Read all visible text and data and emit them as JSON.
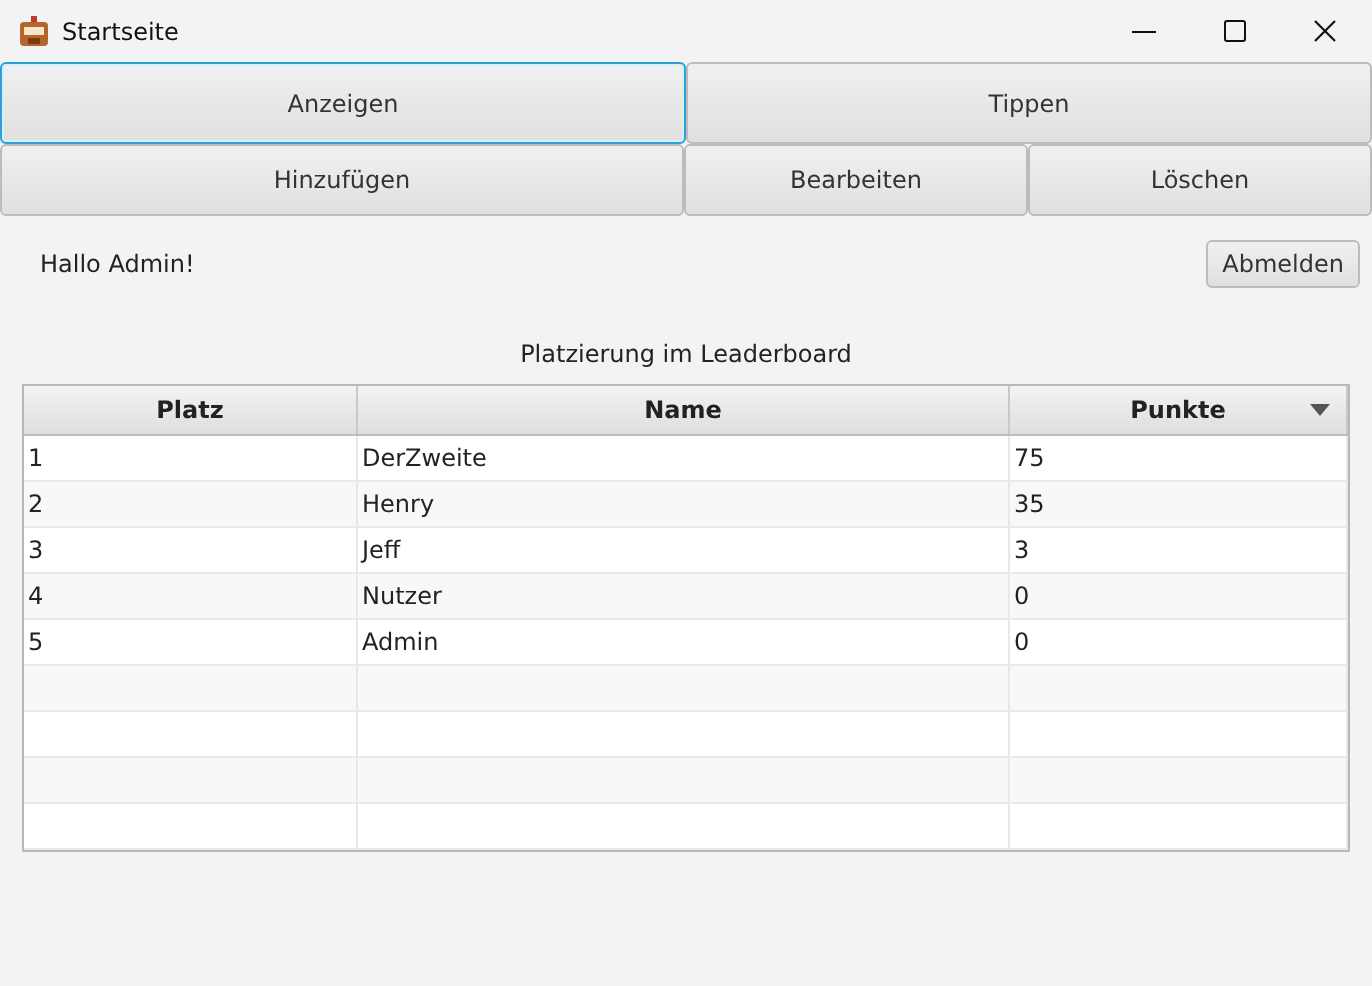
{
  "window": {
    "title": "Startseite"
  },
  "nav_buttons": [
    [
      {
        "label": "Anzeigen",
        "focused": true
      },
      {
        "label": "Tippen",
        "focused": false
      }
    ],
    [
      {
        "label": "Hinzufügen",
        "focused": false
      },
      {
        "label": "Bearbeiten",
        "focused": false
      },
      {
        "label": "Löschen",
        "focused": false
      }
    ]
  ],
  "greeting": "Hallo Admin!",
  "logout_button": "Abmelden",
  "caption": "Platzierung im Leaderboard",
  "table": {
    "columns": [
      {
        "label": "Platz",
        "sorted": false
      },
      {
        "label": "Name",
        "sorted": false
      },
      {
        "label": "Punkte",
        "sorted": true
      }
    ],
    "rows": [
      [
        "1",
        "DerZweite",
        "75"
      ],
      [
        "2",
        "Henry",
        "35"
      ],
      [
        "3",
        "Jeff",
        "3"
      ],
      [
        "4",
        "Nutzer",
        "0"
      ],
      [
        "5",
        "Admin",
        "0"
      ]
    ]
  }
}
